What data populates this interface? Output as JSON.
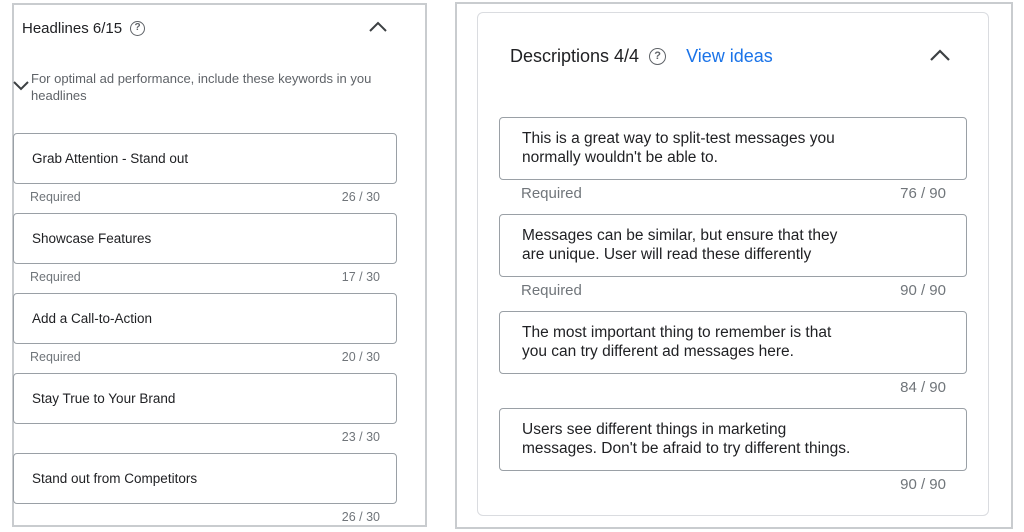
{
  "headlines": {
    "title": "Headlines 6/15",
    "help_icon": "help-circle-icon",
    "collapse_icon": "chevron-up-icon",
    "hint": "For optimal ad performance, include these keywords in your headlines",
    "hint_line1": "For optimal ad performance, include these keywords in you",
    "hint_line2": "headlines",
    "items": [
      {
        "value": "Grab Attention - Stand out",
        "status": "Required",
        "count": "26 / 30"
      },
      {
        "value": "Showcase Features",
        "status": "Required",
        "count": "17 / 30"
      },
      {
        "value": "Add a Call-to-Action",
        "status": "Required",
        "count": "20 / 30"
      },
      {
        "value": "Stay True to Your Brand",
        "status": "",
        "count": "23 / 30"
      },
      {
        "value": "Stand out from Competitors",
        "status": "",
        "count": "26 / 30"
      }
    ]
  },
  "descriptions": {
    "title": "Descriptions 4/4",
    "help_icon": "help-circle-icon",
    "view_ideas": "View ideas",
    "collapse_icon": "chevron-up-icon",
    "items": [
      {
        "line1": "This is a great way to split-test messages you",
        "line2": "normally wouldn't be able to.",
        "status": "Required",
        "count": "76 / 90"
      },
      {
        "line1": "Messages can be similar, but ensure that they",
        "line2": "are unique. User will read these differently",
        "status": "Required",
        "count": "90 / 90"
      },
      {
        "line1": "The most important thing to remember is that",
        "line2": "you can try different ad messages here.",
        "status": "",
        "count": "84 / 90"
      },
      {
        "line1": "Users see different things in marketing",
        "line2": "messages. Don't be afraid to try different things.",
        "status": "",
        "count": "90 / 90"
      }
    ]
  },
  "colors": {
    "link": "#1a73e8",
    "muted": "#70757a",
    "border": "#9aa0a6"
  }
}
